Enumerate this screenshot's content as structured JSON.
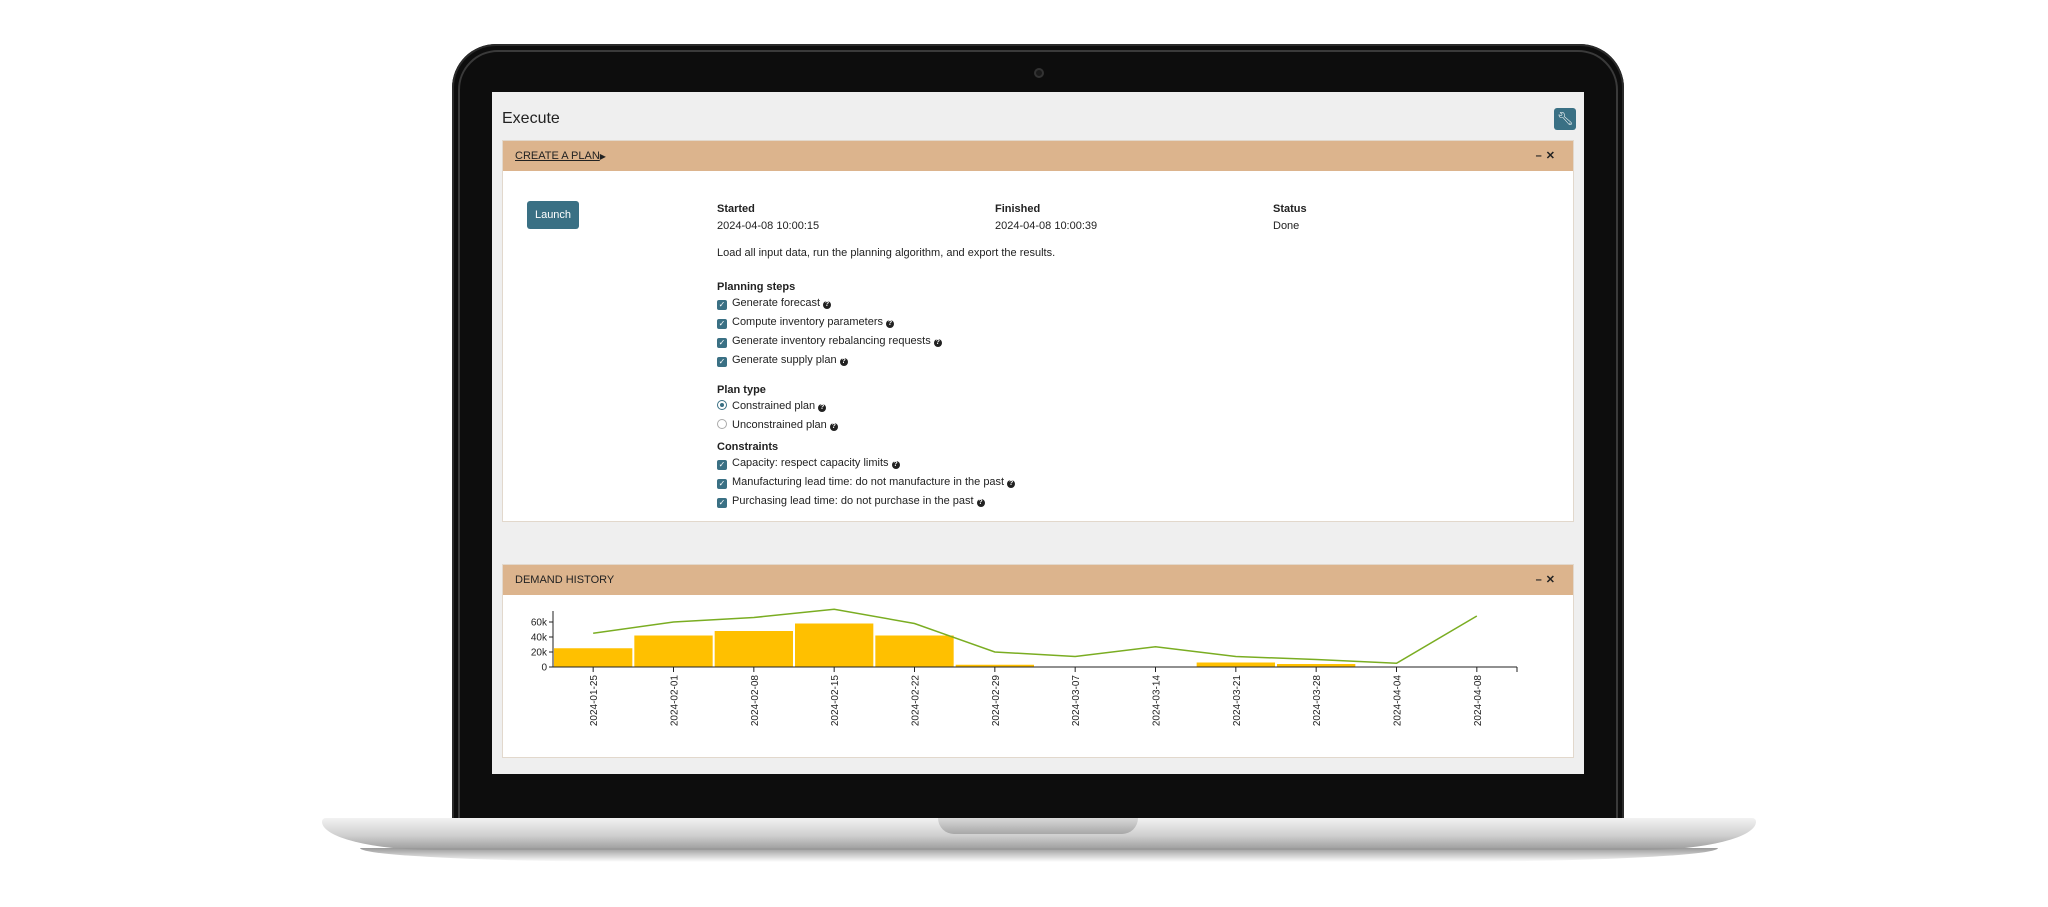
{
  "page": {
    "title": "Execute",
    "wrench_icon": "wrench-icon"
  },
  "create_plan": {
    "header": "CREATE A PLAN",
    "launch_label": "Launch",
    "started_label": "Started",
    "started_value": "2024-04-08 10:00:15",
    "finished_label": "Finished",
    "finished_value": "2024-04-08 10:00:39",
    "status_label": "Status",
    "status_value": "Done",
    "description": "Load all input data, run the planning algorithm, and export the results.",
    "planning_steps_title": "Planning steps",
    "planning_steps": [
      {
        "label": "Generate forecast",
        "checked": true
      },
      {
        "label": "Compute inventory parameters",
        "checked": true
      },
      {
        "label": "Generate inventory rebalancing requests",
        "checked": true
      },
      {
        "label": "Generate supply plan",
        "checked": true
      }
    ],
    "plan_type_title": "Plan type",
    "plan_types": [
      {
        "label": "Constrained plan",
        "selected": true
      },
      {
        "label": "Unconstrained plan",
        "selected": false
      }
    ],
    "constraints_title": "Constraints",
    "constraints": [
      {
        "label": "Capacity: respect capacity limits",
        "checked": true
      },
      {
        "label": "Manufacturing lead time: do not manufacture in the past",
        "checked": true
      },
      {
        "label": "Purchasing lead time: do not purchase in the past",
        "checked": true
      }
    ]
  },
  "demand_history": {
    "header": "DEMAND HISTORY"
  },
  "colors": {
    "accent": "#3a7084",
    "widget_header": "#dcb48d",
    "bar": "#ffc000",
    "line": "#7aad22"
  },
  "chart_data": {
    "type": "bar",
    "categories": [
      "2024-01-25",
      "2024-02-01",
      "2024-02-08",
      "2024-02-15",
      "2024-02-22",
      "2024-02-29",
      "2024-03-07",
      "2024-03-14",
      "2024-03-21",
      "2024-03-28",
      "2024-04-04",
      "2024-04-08"
    ],
    "series": [
      {
        "type": "bar",
        "values": [
          25000,
          42000,
          48000,
          58000,
          42000,
          3000,
          0,
          0,
          6000,
          4000,
          0,
          0
        ]
      },
      {
        "type": "line",
        "values": [
          45000,
          60000,
          66000,
          77000,
          58000,
          20000,
          14000,
          27000,
          14000,
          10000,
          5000,
          68000
        ]
      }
    ],
    "yticks": [
      "0",
      "20k",
      "40k",
      "60k"
    ],
    "ylim": [
      0,
      80000
    ]
  }
}
